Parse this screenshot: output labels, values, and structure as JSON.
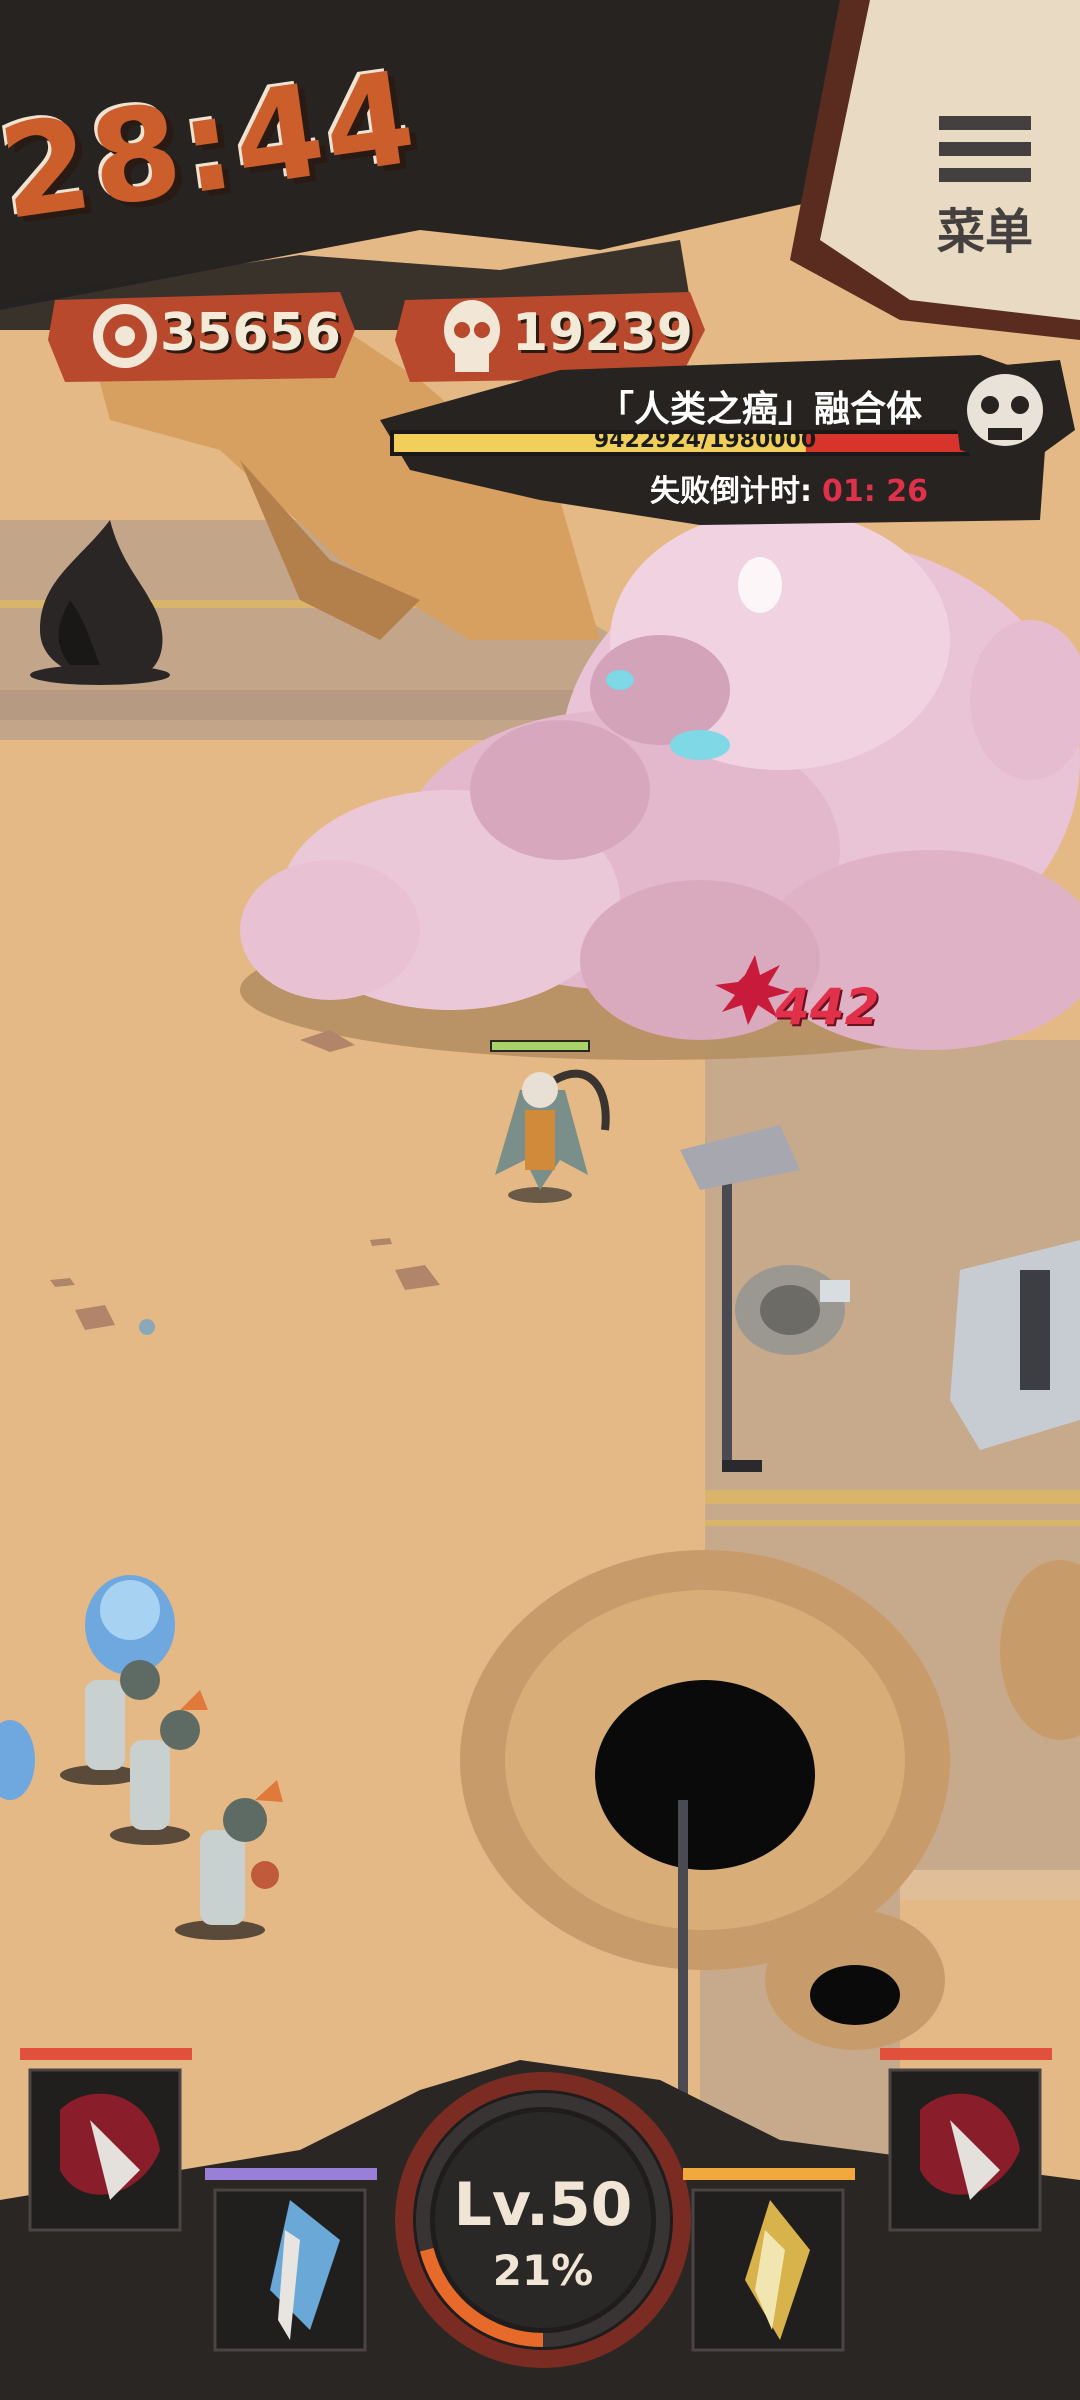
{
  "hud": {
    "timer": "28:44",
    "coins": "35656",
    "kills": "19239",
    "menu_label": "菜单"
  },
  "boss": {
    "name": "「人类之癌」融合体",
    "hp_text": "9422924/1980000",
    "hp_fraction": 0.72,
    "countdown_label": "失败倒计时:",
    "countdown_time": "01: 26"
  },
  "combat": {
    "damage_number": "442"
  },
  "player": {
    "level": "Lv.50",
    "xp_percent": "21%",
    "xp_fraction": 0.21
  },
  "skills": [
    {
      "name": "red-beast-skill",
      "bar_color": "#e0503a"
    },
    {
      "name": "blue-spear-skill",
      "bar_color": "#9a7fd8"
    },
    {
      "name": "gold-blade-skill",
      "bar_color": "#f0a93a"
    },
    {
      "name": "red-beast-skill-right",
      "bar_color": "#e0503a"
    }
  ],
  "colors": {
    "sand": "#e4b985",
    "timer": "#cc5e2c",
    "boss_hp": "#f2cf5a",
    "boss_hp_lost": "#d8342c",
    "damage": "#e0304a"
  }
}
